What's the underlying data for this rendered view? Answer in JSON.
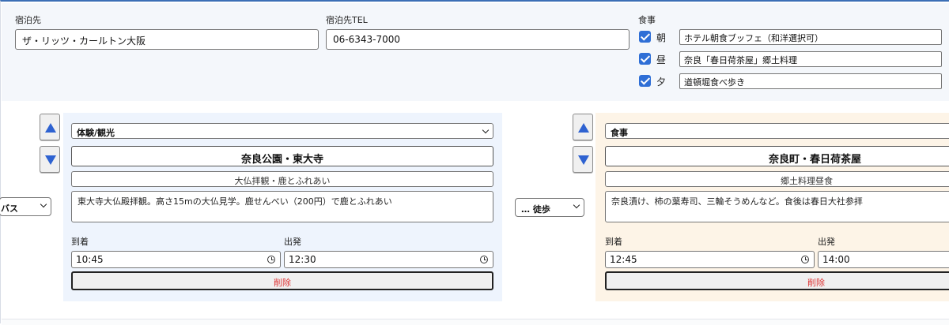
{
  "lodging": {
    "name_label": "宿泊先",
    "name_value": "ザ・リッツ・カールトン大阪",
    "tel_label": "宿泊先TEL",
    "tel_value": "06-6343-7000"
  },
  "meals": {
    "label": "食事",
    "items": [
      {
        "label": "朝",
        "checked": true,
        "value": "ホテル朝食ブッフェ（和洋選択可）"
      },
      {
        "label": "昼",
        "checked": true,
        "value": "奈良「春日荷茶屋」郷土料理"
      },
      {
        "label": "夕",
        "checked": true,
        "value": "道頓堀食べ歩き"
      }
    ]
  },
  "transports": [
    {
      "value": "バス"
    },
    {
      "value": "… 徒歩"
    }
  ],
  "spots": [
    {
      "category": "体験/観光",
      "name": "奈良公園・東大寺",
      "subtitle": "大仏拝観・鹿とふれあい",
      "description": "東大寺大仏殿拝観。高さ15mの大仏見学。鹿せんべい（200円）で鹿とふれあい",
      "arrival_label": "到着",
      "departure_label": "出発",
      "arrival": "10:45",
      "departure": "12:30",
      "delete_label": "削除",
      "bg_color": "#eef4fd"
    },
    {
      "category": "食事",
      "name": "奈良町・春日荷茶屋",
      "subtitle": "郷土料理昼食",
      "description": "奈良漬け、柿の葉寿司、三輪そうめんなど。食後は春日大社参拝",
      "arrival_label": "到着",
      "departure_label": "出発",
      "arrival": "12:45",
      "departure": "14:00",
      "delete_label": "削除",
      "bg_color": "#fdf4e7"
    }
  ],
  "colors": {
    "accent": "#2e62d1",
    "delete_text": "#dd3333",
    "top_band": "#f4f7fb"
  },
  "icons": {
    "move_up": "triangle-up-icon",
    "move_down": "triangle-down-icon",
    "clock": "clock-icon",
    "checkbox": "checkmark-icon",
    "dropdown": "chevron-down-icon"
  }
}
